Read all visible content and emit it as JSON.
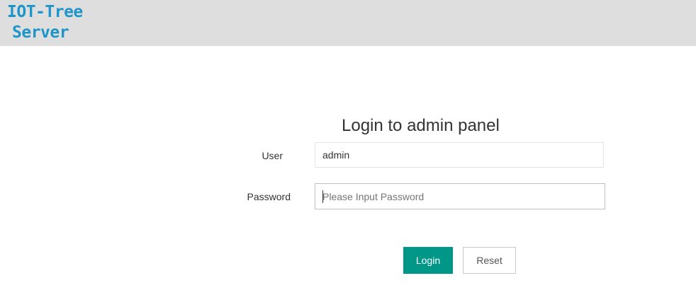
{
  "header": {
    "logo_line1": "IOT-Tree",
    "logo_line2": "Server"
  },
  "login": {
    "title": "Login to admin panel",
    "user_label": "User",
    "user_value": "admin",
    "password_label": "Password",
    "password_placeholder": "Please Input Password",
    "login_label": "Login",
    "reset_label": "Reset"
  },
  "colors": {
    "header_bg": "#dedede",
    "logo": "#1e95c9",
    "primary_button": "#009688"
  }
}
